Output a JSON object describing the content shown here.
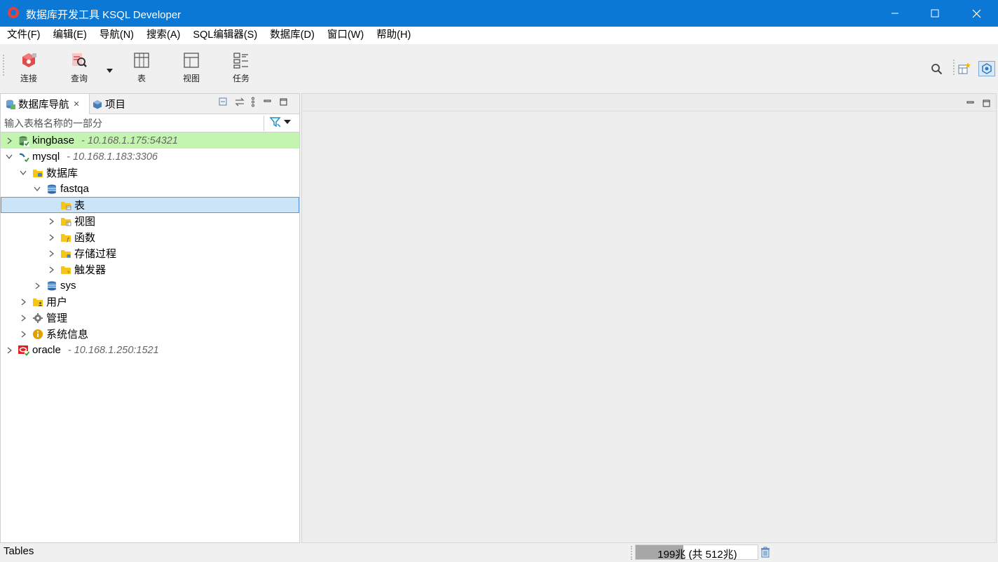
{
  "window": {
    "title": "数据库开发工具 KSQL Developer",
    "controls": [
      "minimize-icon",
      "maximize-icon",
      "close-icon"
    ]
  },
  "menu": [
    {
      "label": "文件(F)"
    },
    {
      "label": "编辑(E)"
    },
    {
      "label": "导航(N)"
    },
    {
      "label": "搜索(A)"
    },
    {
      "label": "SQL编辑器(S)"
    },
    {
      "label": "数据库(D)"
    },
    {
      "label": "窗口(W)"
    },
    {
      "label": "帮助(H)"
    }
  ],
  "toolbar": {
    "connect_label": "连接",
    "query_label": "查询",
    "table_label": "表",
    "view_label": "视图",
    "task_label": "任务"
  },
  "navigator": {
    "tab_db_nav": "数据库导航",
    "tab_project": "项目",
    "filter_placeholder": "输入表格名称的一部分",
    "tree": {
      "kingbase": {
        "label": "kingbase",
        "addr": "- 10.168.1.175:54321"
      },
      "mysql": {
        "label": "mysql",
        "addr": "- 10.168.1.183:3306"
      },
      "databases": "数据库",
      "fastqa": "fastqa",
      "tables": "表",
      "views": "视图",
      "functions": "函数",
      "procedures": "存储过程",
      "triggers": "触发器",
      "sys": "sys",
      "users": "用户",
      "admin": "管理",
      "sysinfo": "系统信息",
      "oracle": {
        "label": "oracle",
        "addr": "- 10.168.1.250:1521"
      }
    }
  },
  "status": {
    "text": "Tables",
    "memory_text": "199兆 (共 512兆)",
    "memory_used_fraction": 0.389
  },
  "colors": {
    "titlebar": "#0a78d4",
    "highlight_green": "#c4f5b0",
    "selection": "#cce4f7",
    "folder": "#f5c518"
  }
}
